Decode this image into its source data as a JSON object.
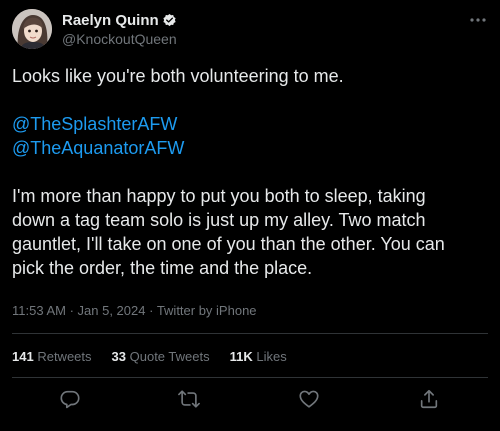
{
  "tweet": {
    "author": {
      "display_name": "Raelyn Quinn",
      "handle": "@KnockoutQueen",
      "verified": true
    },
    "body": {
      "line1": "Looks like you're both volunteering to me.",
      "mention1": "@TheSplashterAFW",
      "mention2": "@TheAquanatorAFW",
      "para_lines": [
        "I'm more than happy to put you both to sleep, taking",
        "down a tag team solo is just up my alley. Two match",
        "gauntlet, I'll take on one of you than the other. You can",
        "pick the order, the time and the place."
      ]
    },
    "meta": {
      "time": "11:53 AM",
      "separator": " · ",
      "date": "Jan 5, 2024",
      "source": "Twitter by iPhone"
    },
    "stats": {
      "retweets_count": "141",
      "retweets_label": "Retweets",
      "quotes_count": "33",
      "quotes_label": "Quote Tweets",
      "likes_count": "11K",
      "likes_label": "Likes"
    },
    "actions": [
      "reply-icon",
      "retweet-icon",
      "like-icon",
      "share-icon"
    ]
  },
  "colors": {
    "background": "#000000",
    "text": "#e7e9ea",
    "secondary": "#71767b",
    "link": "#1d9bf0",
    "divider": "#2f3336"
  }
}
